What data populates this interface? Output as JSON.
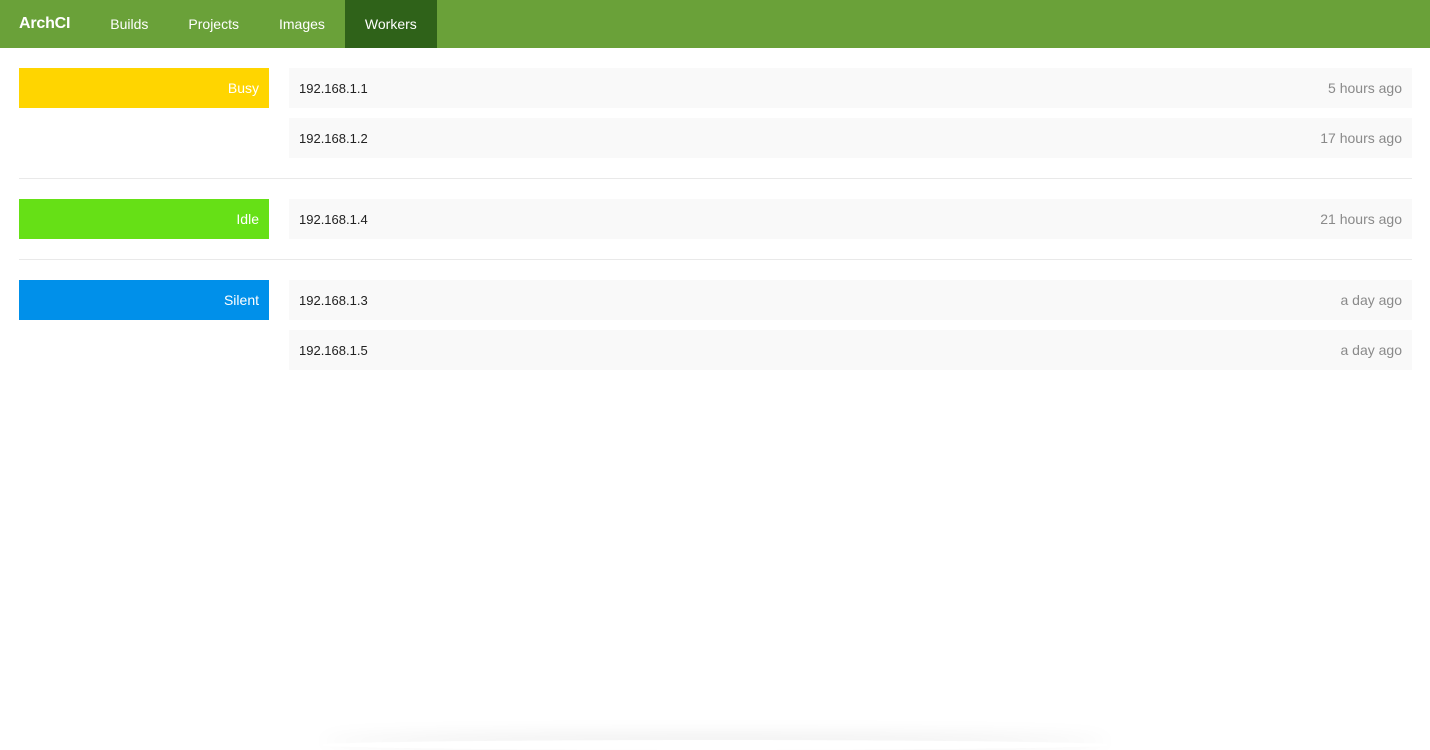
{
  "nav": {
    "brand": "ArchCI",
    "items": [
      {
        "label": "Builds"
      },
      {
        "label": "Projects"
      },
      {
        "label": "Images"
      },
      {
        "label": "Workers"
      }
    ],
    "active": "Workers",
    "color": "#6aa139",
    "active_color": "#2f6219"
  },
  "groups": [
    {
      "status": "Busy",
      "color": "#ffd500",
      "workers": [
        {
          "ip": "192.168.1.1",
          "time": "5 hours ago"
        },
        {
          "ip": "192.168.1.2",
          "time": "17 hours ago"
        }
      ]
    },
    {
      "status": "Idle",
      "color": "#66e016",
      "workers": [
        {
          "ip": "192.168.1.4",
          "time": "21 hours ago"
        }
      ]
    },
    {
      "status": "Silent",
      "color": "#0090ea",
      "workers": [
        {
          "ip": "192.168.1.3",
          "time": "a day ago"
        },
        {
          "ip": "192.168.1.5",
          "time": "a day ago"
        }
      ]
    }
  ]
}
